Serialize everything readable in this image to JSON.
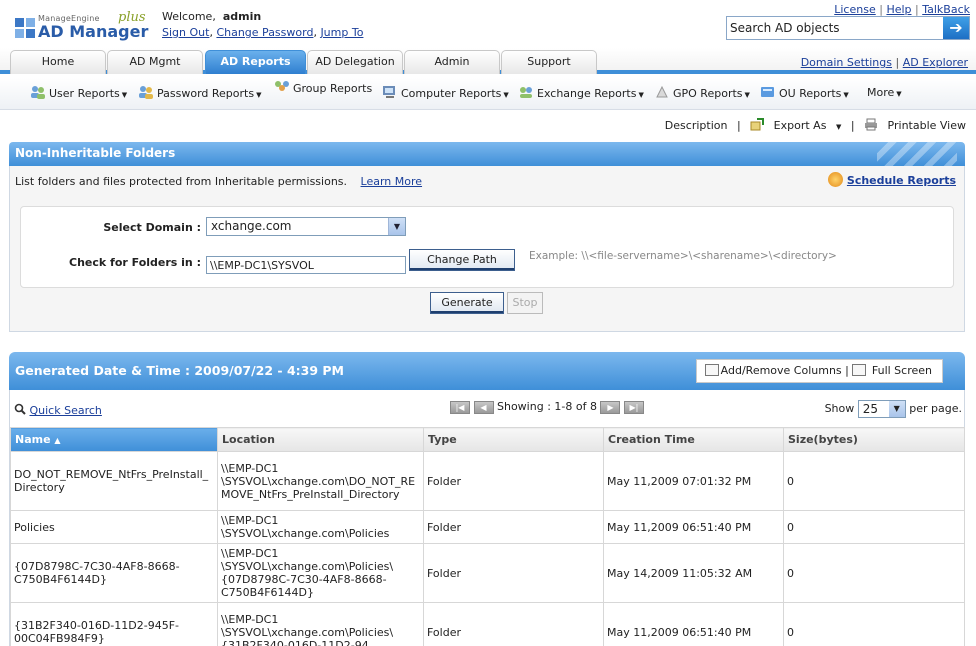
{
  "app": {
    "logo_brand_top": "ManageEngine",
    "logo_brand_main": "AD Manager",
    "logo_plus": "plus"
  },
  "header": {
    "welcome_prefix": "Welcome,",
    "username": "admin",
    "sign_out": "Sign Out",
    "change_password": "Change Password",
    "jump_to": "Jump To",
    "license": "License",
    "help": "Help",
    "talkback": "TalkBack",
    "search_placeholder": "Search AD objects"
  },
  "tabs": [
    {
      "label": "Home"
    },
    {
      "label": "AD Mgmt"
    },
    {
      "label": "AD Reports",
      "active": true
    },
    {
      "label": "AD Delegation"
    },
    {
      "label": "Admin"
    },
    {
      "label": "Support"
    }
  ],
  "domain_links": {
    "domain_settings": "Domain Settings",
    "ad_explorer": "AD Explorer"
  },
  "submenu": [
    {
      "label": "User Reports",
      "icon": "users-icon"
    },
    {
      "label": "Password Reports",
      "icon": "password-users-icon"
    },
    {
      "label": "Group Reports",
      "icon": "group-icon"
    },
    {
      "label": "Computer Reports",
      "icon": "computer-icon"
    },
    {
      "label": "Exchange Reports",
      "icon": "exchange-icon"
    },
    {
      "label": "GPO Reports",
      "icon": "gpo-icon"
    },
    {
      "label": "OU Reports",
      "icon": "ou-icon"
    },
    {
      "label": "More"
    }
  ],
  "actions": {
    "description": "Description",
    "export_as": "Export As",
    "printable_view": "Printable View"
  },
  "report": {
    "title": "Non-Inheritable Folders",
    "description": "List folders and files protected from Inheritable permissions.",
    "learn_more": "Learn More",
    "schedule_reports": "Schedule Reports",
    "select_domain_label": "Select Domain :",
    "select_domain_value": "xchange.com",
    "check_folders_label": "Check for Folders in :",
    "path_value": "\\\\EMP-DC1\\SYSVOL",
    "change_path": "Change Path",
    "example": "Example: \\\\<file-servername>\\<sharename>\\<directory>",
    "generate": "Generate",
    "stop": "Stop"
  },
  "results": {
    "generated": "Generated Date & Time : 2009/07/22 - 4:39 PM",
    "add_remove_columns": "Add/Remove Columns",
    "full_screen": "Full Screen",
    "quick_search": "Quick Search",
    "showing": "Showing : 1-8 of 8",
    "show_label": "Show",
    "per_page": "25",
    "per_page_suffix": "per page.",
    "columns": [
      "Name",
      "Location",
      "Type",
      "Creation Time",
      "Size(bytes)"
    ],
    "sorted_column": "Name",
    "rows": [
      {
        "name": "DO_NOT_REMOVE_NtFrs_PreInstall_Directory",
        "location": "\\\\EMP-DC1 \\SYSVOL\\xchange.com\\DO_NOT_REMOVE_NtFrs_PreInstall_Directory",
        "type": "Folder",
        "created": "May 11,2009 07:01:32 PM",
        "size": "0"
      },
      {
        "name": "Policies",
        "location": "\\\\EMP-DC1 \\SYSVOL\\xchange.com\\Policies",
        "type": "Folder",
        "created": "May 11,2009 06:51:40 PM",
        "size": "0"
      },
      {
        "name": "{07D8798C-7C30-4AF8-8668-C750B4F6144D}",
        "location": "\\\\EMP-DC1 \\SYSVOL\\xchange.com\\Policies\\{07D8798C-7C30-4AF8-8668-C750B4F6144D}",
        "type": "Folder",
        "created": "May 14,2009 11:05:32 AM",
        "size": "0"
      },
      {
        "name": "{31B2F340-016D-11D2-945F-00C04FB984F9}",
        "location": "\\\\EMP-DC1 \\SYSVOL\\xchange.com\\Policies\\{31B2F340-016D-11D2-94",
        "type": "Folder",
        "created": "May 11,2009 06:51:40 PM",
        "size": "0"
      }
    ]
  }
}
